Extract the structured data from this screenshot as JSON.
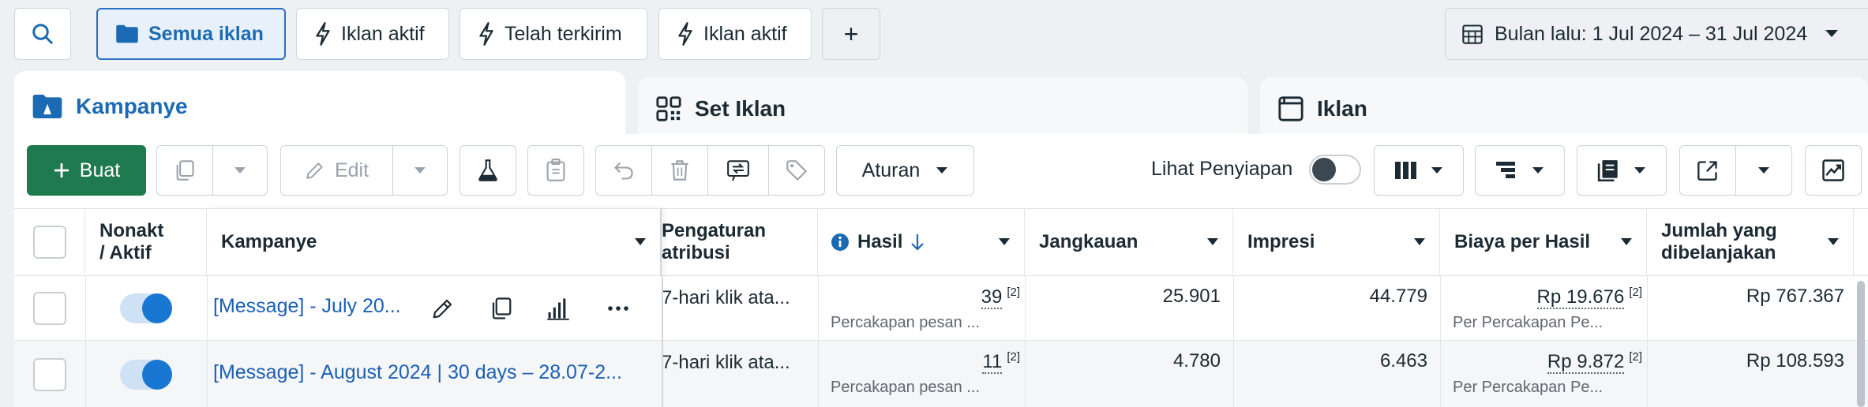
{
  "filters": {
    "all_ads": "Semua iklan",
    "active_ads_1": "Iklan aktif",
    "delivered": "Telah terkirim",
    "active_ads_2": "Iklan aktif",
    "add": "+",
    "date_range": "Bulan lalu: 1 Jul 2024 – 31 Jul 2024"
  },
  "tabs": {
    "campaigns": "Kampanye",
    "ad_sets": "Set Iklan",
    "ads": "Iklan"
  },
  "toolbar": {
    "create": "Buat",
    "edit": "Edit",
    "rules": "Aturan",
    "view_setup": "Lihat Penyiapan"
  },
  "table": {
    "headers": {
      "off_on_line1": "Nonakt",
      "off_on_line2": "/ Aktif",
      "campaign": "Kampanye",
      "attribution_line1": "Pengaturan",
      "attribution_line2": "atribusi",
      "results": "Hasil",
      "reach": "Jangkauan",
      "impressions": "Impresi",
      "cost_per_result": "Biaya per Hasil",
      "amount_spent_line1": "Jumlah yang",
      "amount_spent_line2": "dibelanjakan"
    },
    "rows": [
      {
        "campaign": "[Message] - July 20...",
        "attribution": "7-hari klik ata...",
        "results": "39",
        "results_note": "[2]",
        "results_sub": "Percakapan pesan ...",
        "reach": "25.901",
        "impressions": "44.779",
        "cost_per_result": "Rp 19.676",
        "cost_note": "[2]",
        "cost_sub": "Per Percakapan Pe...",
        "amount_spent": "Rp 767.367"
      },
      {
        "campaign": "[Message] - August 2024 | 30 days – 28.07-2...",
        "attribution": "7-hari klik ata...",
        "results": "11",
        "results_note": "[2]",
        "results_sub": "Percakapan pesan ...",
        "reach": "4.780",
        "impressions": "6.463",
        "cost_per_result": "Rp 9.872",
        "cost_note": "[2]",
        "cost_sub": "Per Percakapan Pe...",
        "amount_spent": "Rp 108.593"
      }
    ]
  },
  "colors": {
    "accent": "#1b6ab4",
    "create_button": "#1f7a4f",
    "toggle_on": "#1877d2"
  }
}
